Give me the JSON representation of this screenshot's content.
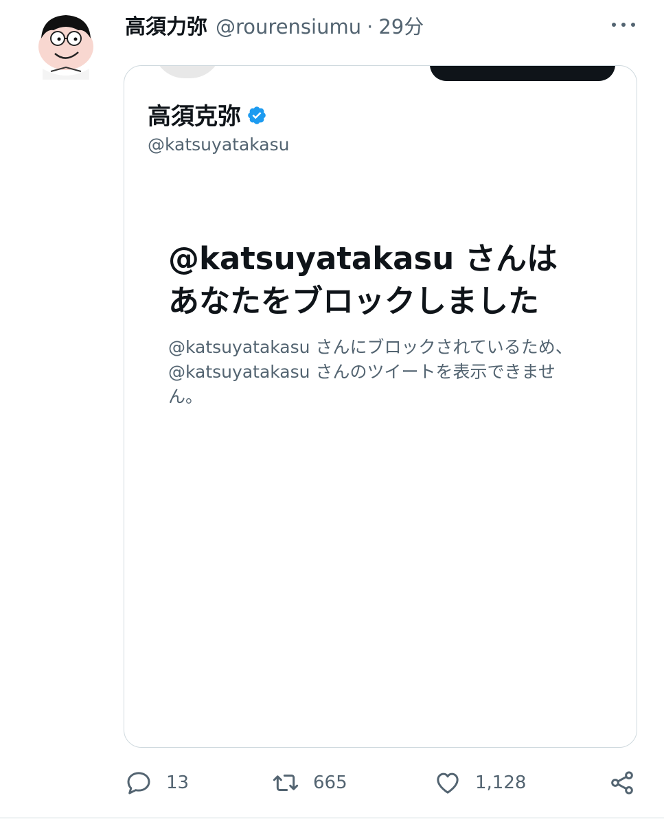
{
  "tweet": {
    "display_name": "高須力弥",
    "handle": "@rourensiumu",
    "separator": "·",
    "time": "29分",
    "avatar_icon": "cartoon-avatar-icon",
    "more_icon": "more-horizontal-icon"
  },
  "card": {
    "name": "高須克弥",
    "verified_icon": "verified-badge-icon",
    "verified_color": "#1d9bf0",
    "handle": "@katsuyatakasu",
    "title_line1": "@katsuyatakasu さんは",
    "title_line2": "あなたをブロックしました",
    "body_line1": "@katsuyatakasu さんにブロックされているため、",
    "body_line2": "@katsuyatakasu さんのツイートを表示できませ",
    "body_line3": "ん。"
  },
  "actions": {
    "reply": {
      "icon": "reply-icon",
      "count": "13"
    },
    "retweet": {
      "icon": "retweet-icon",
      "count": "665"
    },
    "like": {
      "icon": "like-icon",
      "count": "1,128"
    },
    "share": {
      "icon": "share-icon"
    }
  },
  "colors": {
    "text_primary": "#0f1419",
    "text_secondary": "#536471",
    "border": "#cfd9de",
    "accent": "#1d9bf0"
  }
}
